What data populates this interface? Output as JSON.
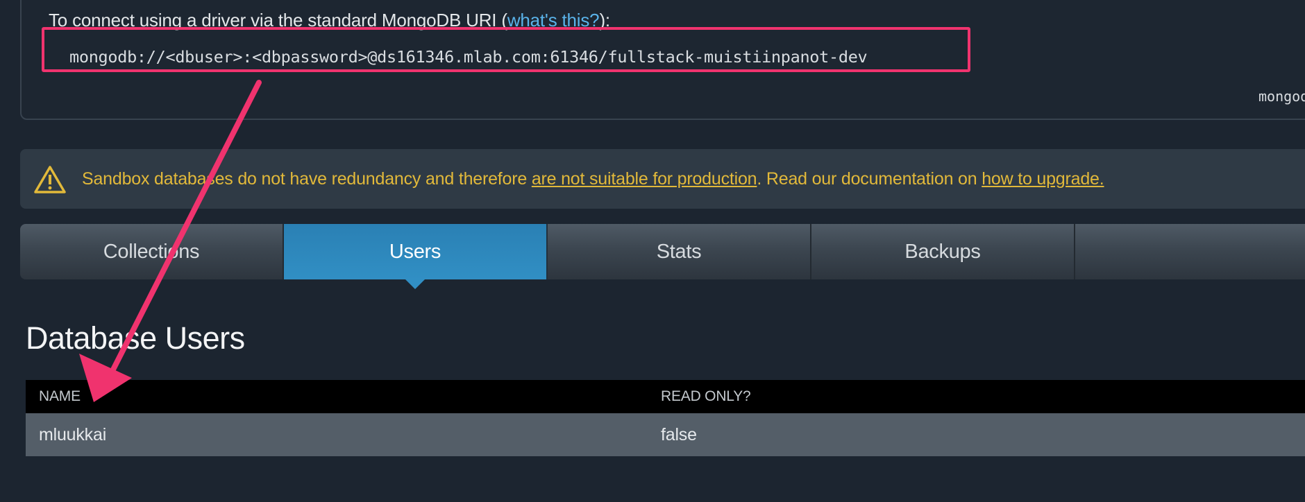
{
  "connection": {
    "intro_before": "To connect using a driver via the standard MongoDB URI (",
    "intro_link": "what's this?",
    "intro_after": "):",
    "uri": "mongodb://<dbuser>:<dbpassword>@ds161346.mlab.com:61346/fullstack-muistiinpanot-dev",
    "shell_text_cropped": "mongod"
  },
  "warning": {
    "icon": "warning-triangle-icon",
    "text_1": "Sandbox databases do not have redundancy and therefore ",
    "link_1": "are not suitable for production",
    "text_2": ". Read our documentation on ",
    "link_2": "how to upgrade."
  },
  "tabs": [
    {
      "label": "Collections"
    },
    {
      "label": "Users"
    },
    {
      "label": "Stats"
    },
    {
      "label": "Backups"
    },
    {
      "label": ""
    }
  ],
  "active_tab": "Users",
  "users": {
    "title": "Database Users",
    "columns": {
      "name": "NAME",
      "read_only": "READ ONLY?"
    },
    "rows": [
      {
        "name": "mluukkai",
        "read_only": "false"
      }
    ]
  },
  "colors": {
    "highlight": "#f0336e",
    "active_tab": "#318fc4",
    "warning_text": "#e2b93a",
    "link": "#5ab3ea"
  }
}
